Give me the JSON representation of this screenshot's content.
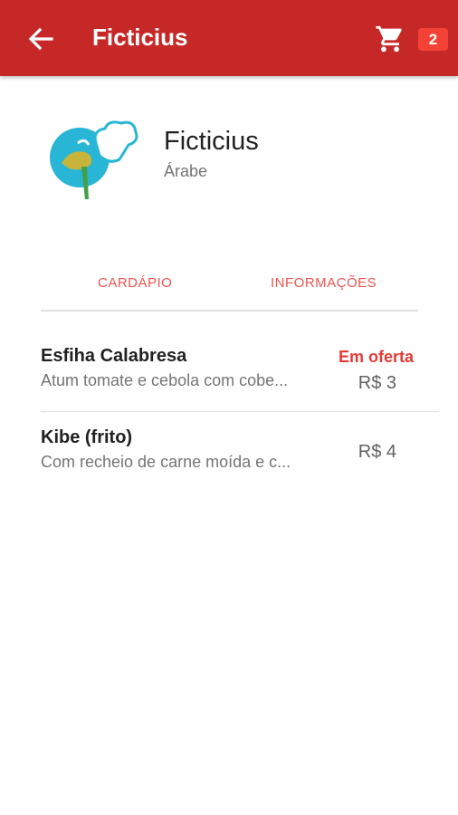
{
  "appbar": {
    "title": "Ficticius",
    "cart_count": "2",
    "back_icon": "arrow-left-icon",
    "cart_icon": "shopping-cart-icon",
    "color": "#c62828"
  },
  "restaurant": {
    "name": "Ficticius",
    "category": "Árabe",
    "logo_icon": "chef-hat-logo"
  },
  "tabs": [
    {
      "label": "CARDÁPIO"
    },
    {
      "label": "INFORMAÇÕES"
    }
  ],
  "menu": [
    {
      "name": "Esfiha Calabresa",
      "description": "Atum tomate e cebola com cobe...",
      "offer": "Em oferta",
      "price": "R$ 3"
    },
    {
      "name": "Kibe (frito)",
      "description": "Com recheio de carne moída e c...",
      "price": "R$ 4"
    }
  ],
  "colors": {
    "accent": "#ef5350",
    "offer": "#e53935",
    "badge": "#f44336"
  }
}
